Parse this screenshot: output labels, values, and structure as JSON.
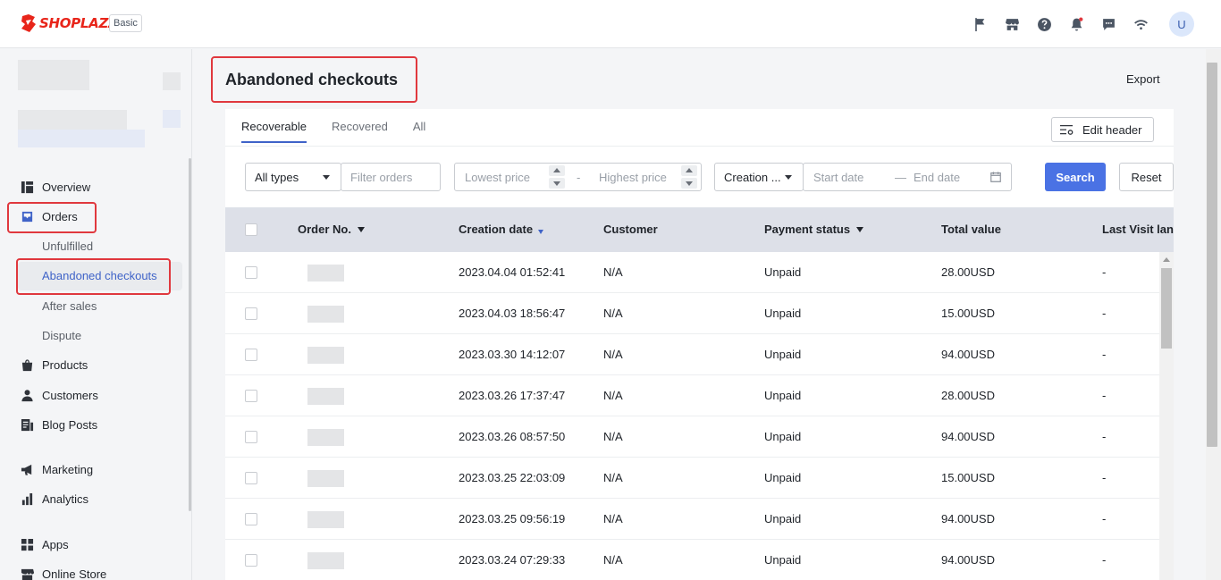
{
  "app": {
    "brand": "SHOPLAZZA",
    "plan": "Basic",
    "avatar_initial": "U"
  },
  "top_icons": [
    "flag-icon",
    "store-icon",
    "help-icon",
    "bell-icon",
    "message-icon",
    "wifi-icon"
  ],
  "sidebar": {
    "items": [
      {
        "label": "Overview",
        "icon": "overview-icon"
      },
      {
        "label": "Orders",
        "icon": "orders-icon"
      },
      {
        "label": "Products",
        "icon": "products-icon"
      },
      {
        "label": "Customers",
        "icon": "customers-icon"
      },
      {
        "label": "Blog Posts",
        "icon": "blog-icon"
      },
      {
        "label": "Marketing",
        "icon": "marketing-icon"
      },
      {
        "label": "Analytics",
        "icon": "analytics-icon"
      },
      {
        "label": "Apps",
        "icon": "apps-icon"
      },
      {
        "label": "Online Store",
        "icon": "online-store-icon"
      }
    ],
    "order_subitems": [
      "Unfulfilled",
      "Abandoned checkouts",
      "After sales",
      "Dispute"
    ]
  },
  "page": {
    "title": "Abandoned checkouts",
    "export_label": "Export"
  },
  "tabs": [
    "Recoverable",
    "Recovered",
    "All"
  ],
  "edit_header_label": "Edit header",
  "filters": {
    "type_value": "All types",
    "filter_placeholder": "Filter orders",
    "lowest_price_placeholder": "Lowest price",
    "range_sep": "-",
    "highest_price_placeholder": "Highest price",
    "date_type_value": "Creation ...",
    "start_date_placeholder": "Start date",
    "date_sep": "—",
    "end_date_placeholder": "End date",
    "search_label": "Search",
    "reset_label": "Reset"
  },
  "table": {
    "columns": [
      "Order No.",
      "Creation date",
      "Customer",
      "Payment status",
      "Total value",
      "Last Visit land"
    ],
    "rows": [
      {
        "date": "2023.04.04 01:52:41",
        "customer": "N/A",
        "payment": "Unpaid",
        "total": "28.00USD",
        "last_visit": "-"
      },
      {
        "date": "2023.04.03 18:56:47",
        "customer": "N/A",
        "payment": "Unpaid",
        "total": "15.00USD",
        "last_visit": "-"
      },
      {
        "date": "2023.03.30 14:12:07",
        "customer": "N/A",
        "payment": "Unpaid",
        "total": "94.00USD",
        "last_visit": "-"
      },
      {
        "date": "2023.03.26 17:37:47",
        "customer": "N/A",
        "payment": "Unpaid",
        "total": "28.00USD",
        "last_visit": "-"
      },
      {
        "date": "2023.03.26 08:57:50",
        "customer": "N/A",
        "payment": "Unpaid",
        "total": "94.00USD",
        "last_visit": "-"
      },
      {
        "date": "2023.03.25 22:03:09",
        "customer": "N/A",
        "payment": "Unpaid",
        "total": "15.00USD",
        "last_visit": "-"
      },
      {
        "date": "2023.03.25 09:56:19",
        "customer": "N/A",
        "payment": "Unpaid",
        "total": "94.00USD",
        "last_visit": "-"
      },
      {
        "date": "2023.03.24 07:29:33",
        "customer": "N/A",
        "payment": "Unpaid",
        "total": "94.00USD",
        "last_visit": "-"
      }
    ]
  },
  "colors": {
    "accent": "#4a72e4",
    "highlight": "#e0383e",
    "brand": "#e8251a"
  }
}
